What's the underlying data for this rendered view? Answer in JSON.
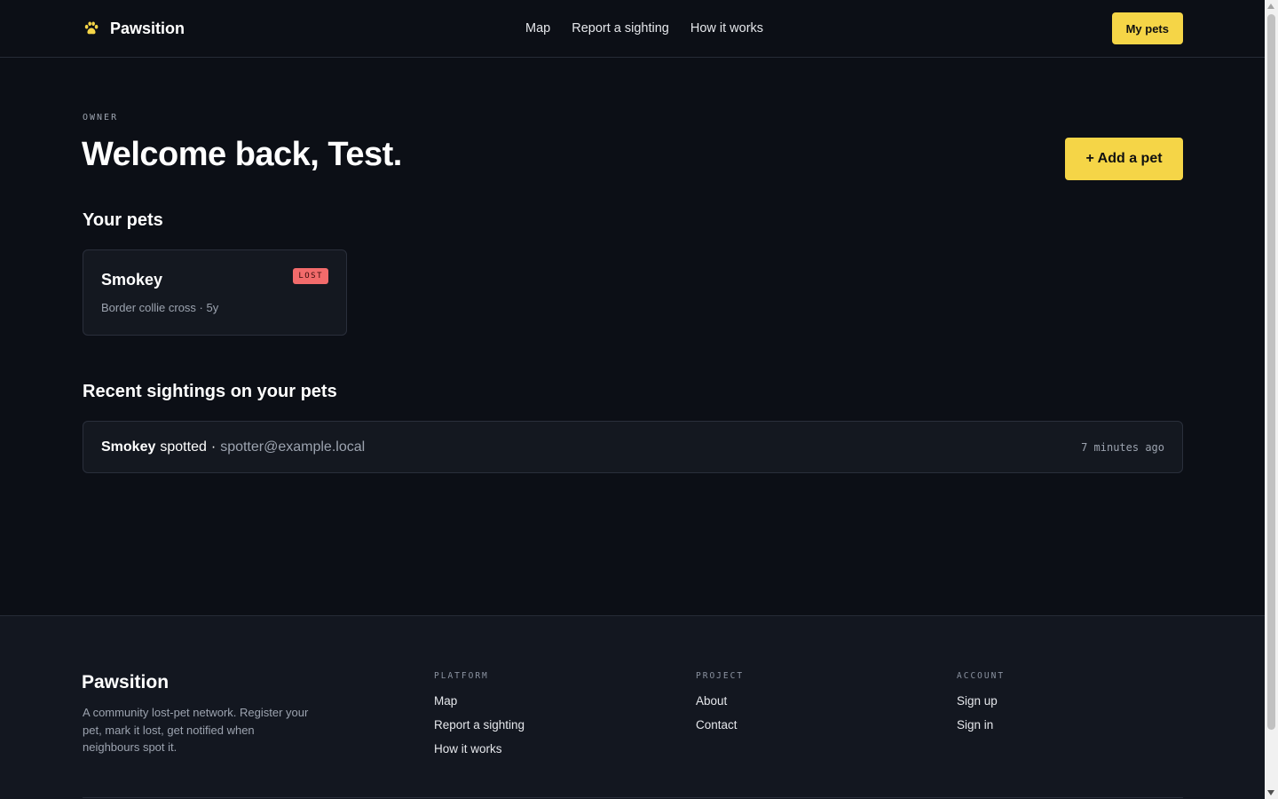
{
  "header": {
    "brand": "Pawsition",
    "nav": [
      "Map",
      "Report a sighting",
      "How it works"
    ],
    "my_pets_label": "My pets"
  },
  "main": {
    "eyebrow": "OWNER",
    "title": "Welcome back, Test.",
    "add_pet_label": "+ Add a pet",
    "pets_heading": "Your pets",
    "pets": [
      {
        "name": "Smokey",
        "meta": "Border collie cross · 5y",
        "status": "LOST"
      }
    ],
    "sightings_heading": "Recent sightings on your pets",
    "sightings": [
      {
        "pet": "Smokey",
        "verb": "spotted",
        "separator": "·",
        "spotter": "spotter@example.local",
        "time": "7 minutes ago"
      }
    ]
  },
  "footer": {
    "brand": "Pawsition",
    "description": "A community lost-pet network. Register your pet, mark it lost, get notified when neighbours spot it.",
    "columns": [
      {
        "heading": "PLATFORM",
        "links": [
          "Map",
          "Report a sighting",
          "How it works"
        ]
      },
      {
        "heading": "PROJECT",
        "links": [
          "About",
          "Contact"
        ]
      },
      {
        "heading": "ACCOUNT",
        "links": [
          "Sign up",
          "Sign in"
        ]
      }
    ]
  },
  "colors": {
    "background": "#0c0f16",
    "accent": "#f5d547",
    "lost_badge": "#f26b6b",
    "card": "#141820",
    "footer": "#131720"
  },
  "icons": {
    "brand": "paw-icon"
  }
}
